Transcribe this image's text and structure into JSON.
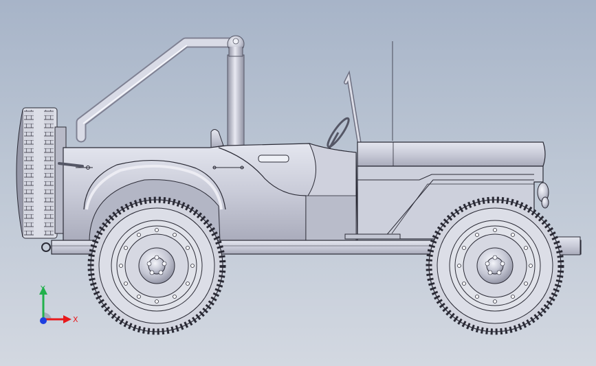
{
  "axes": {
    "x_label": "X",
    "y_label": "Y",
    "x_color": "#e8191c",
    "y_color": "#22b14c",
    "z_color": "#1e3fe0"
  },
  "model": {
    "body_color": "#c9cbd8",
    "edge_color": "#2a2a35",
    "background_top": "#a7b4c8",
    "background_bottom": "#d3d8e1"
  }
}
